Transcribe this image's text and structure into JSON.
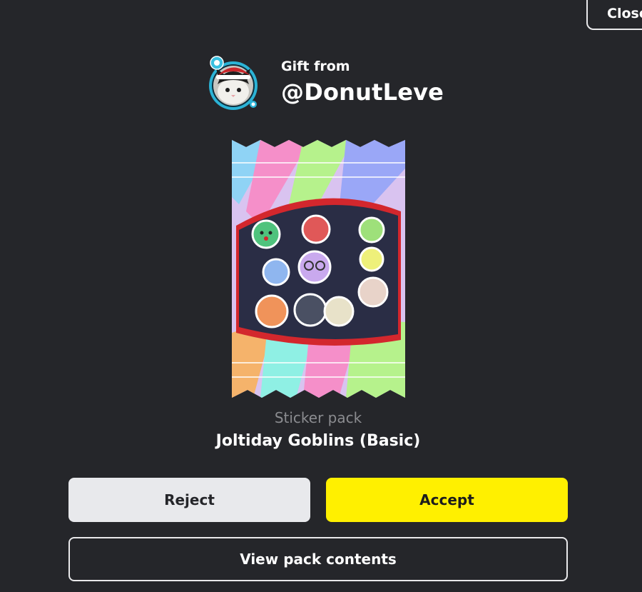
{
  "close_button": {
    "label": "Close"
  },
  "gift": {
    "from_label": "Gift from",
    "username": "@DonutLeve",
    "avatar_icon": "cat-avatar-icon"
  },
  "pack": {
    "type_label": "Sticker pack",
    "name": "Joltiday Goblins (Basic)",
    "art_icon": "sticker-pack-icon"
  },
  "actions": {
    "reject_label": "Reject",
    "accept_label": "Accept",
    "view_contents_label": "View pack contents"
  },
  "colors": {
    "background": "#25262a",
    "accept": "#fff000",
    "reject": "#e8e9ec",
    "muted_text": "#8b8c90"
  }
}
